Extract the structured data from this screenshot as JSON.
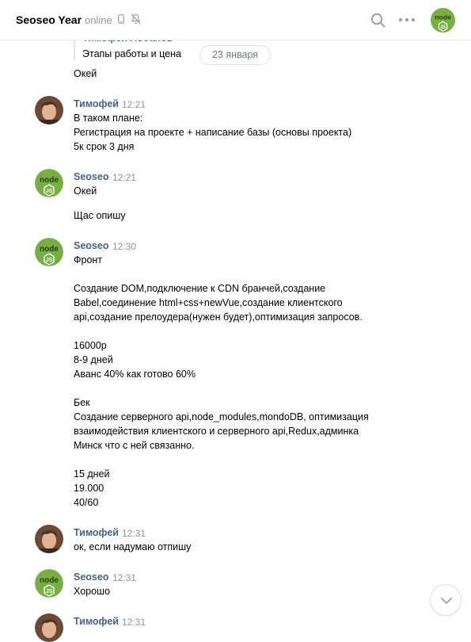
{
  "header": {
    "title": "Seoseo Year",
    "status": "online",
    "avatar_text": "node"
  },
  "reply": {
    "author": "Тимофей Лобанов",
    "text": "Этапы работы и цена"
  },
  "date_pill": "23 января",
  "continuation": [
    "Окей"
  ],
  "messages": [
    {
      "author": "Тимофей",
      "time": "12:21",
      "avatar": "photo",
      "lines": [
        "В таком плане:",
        "Регистрация на проекте + написание базы (основы проекта)",
        "5к срок 3 дня"
      ]
    },
    {
      "author": "Seoseo",
      "time": "12:21",
      "avatar": "node",
      "lines": [
        "Окей",
        "",
        "Щас опишу"
      ]
    },
    {
      "author": "Seoseo",
      "time": "12:30",
      "avatar": "node",
      "lines": [
        "Фронт",
        "",
        "Создание DOM,подключение к CDN бранчей,создание",
        "Babel,соединение html+css+newVue,создание клиентского",
        "api,создание прелоудера(нужен будет),оптимизация запросов.",
        "",
        "16000р",
        "8-9 дней",
        "Аванс 40% как готово 60%",
        "",
        "Бек",
        "Создание серверного api,node_modules,mondoDB, оптимизация",
        "взаимодействия клиентского и серверного api,Redux,админка",
        "Минск что с ней связанно.",
        "",
        "15 дней",
        "19.000",
        "40/60"
      ]
    },
    {
      "author": "Тимофей",
      "time": "12:31",
      "avatar": "photo",
      "lines": [
        "ок, если надумаю отпишу"
      ]
    },
    {
      "author": "Seoseo",
      "time": "12:31",
      "avatar": "node",
      "lines": [
        "Хорошо"
      ]
    },
    {
      "author": "Тимофей",
      "time": "12:31",
      "avatar": "photo",
      "lines": []
    }
  ]
}
